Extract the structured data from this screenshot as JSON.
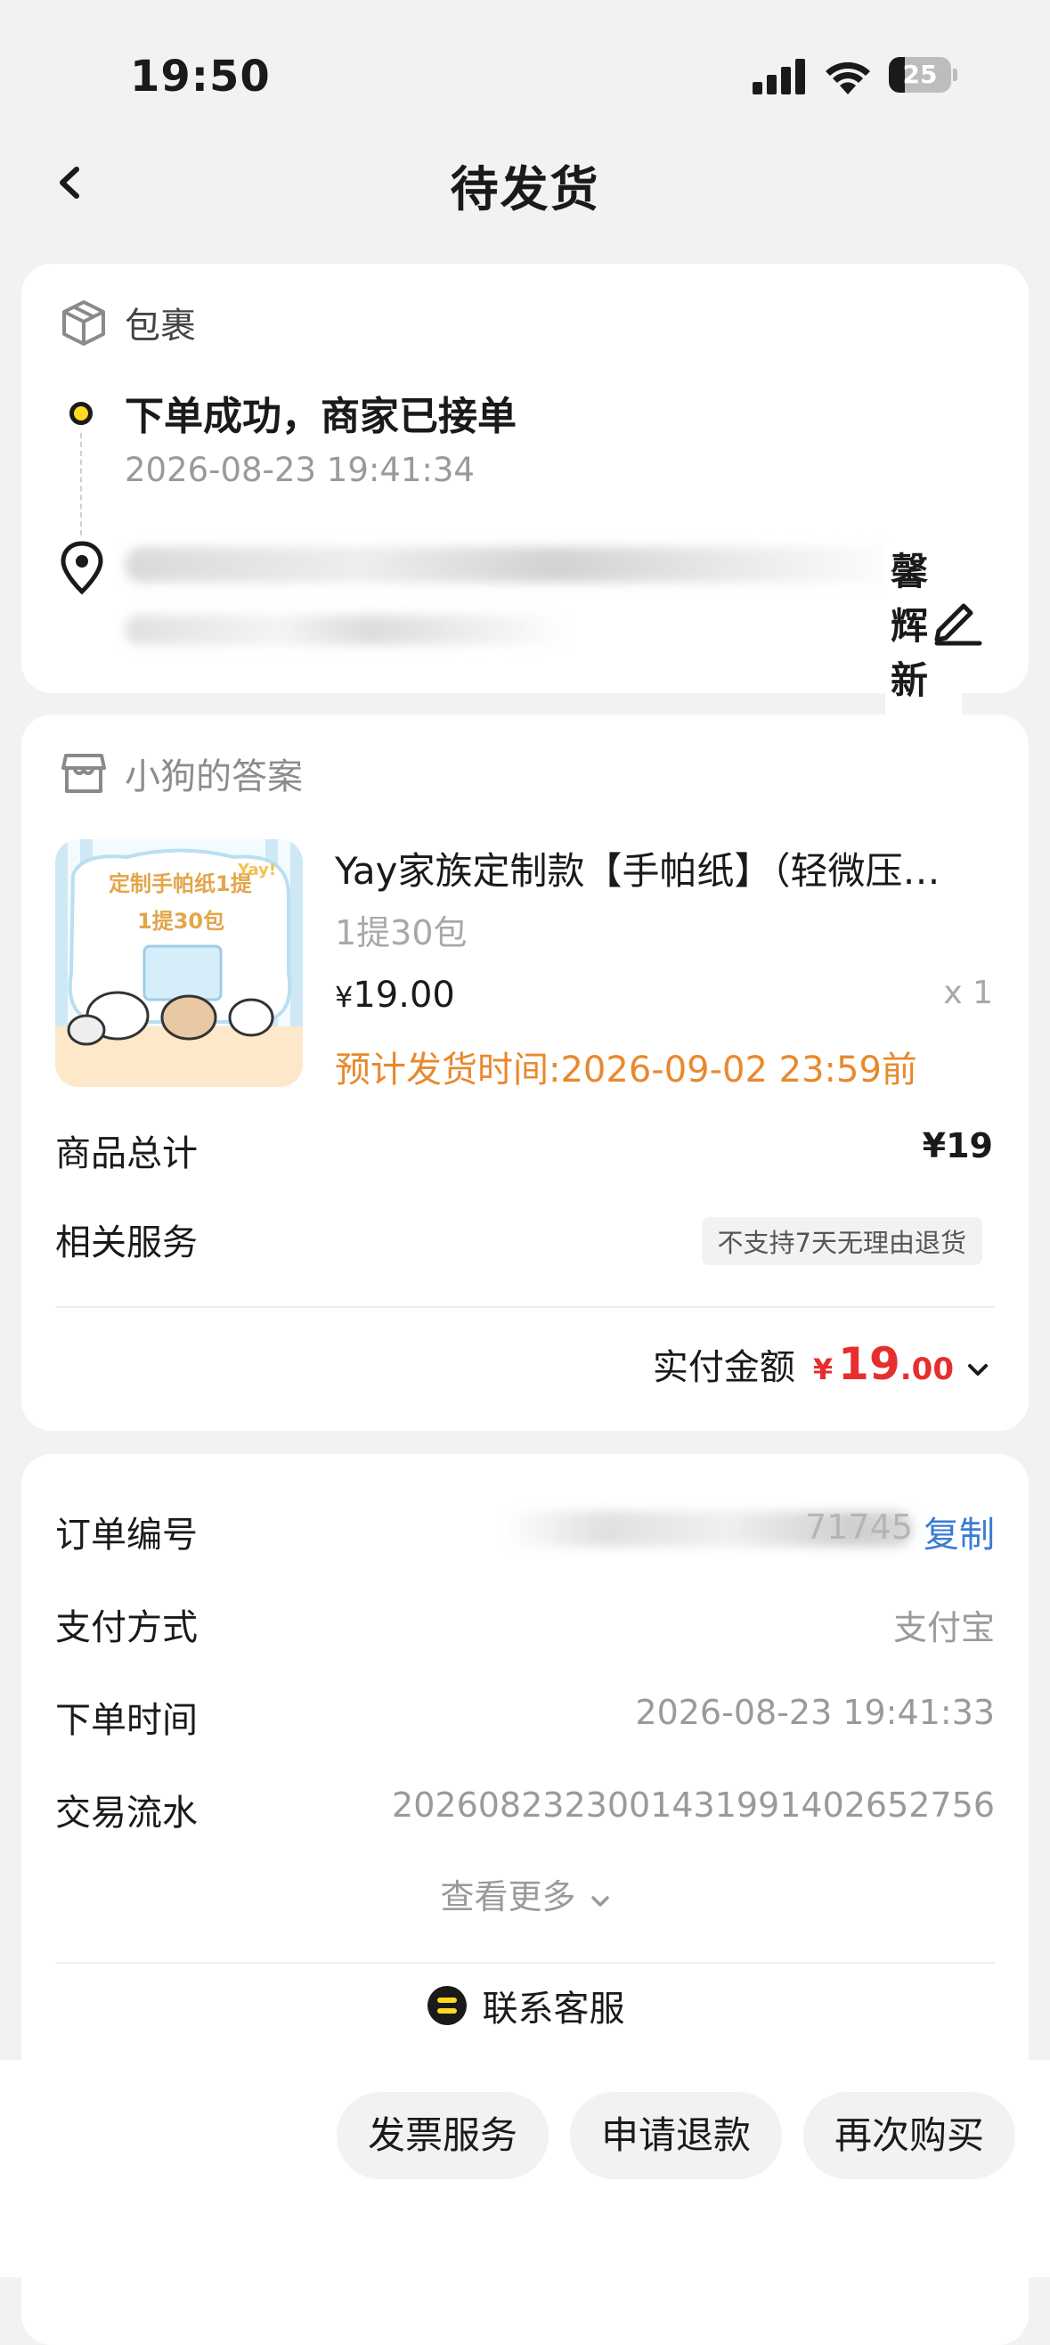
{
  "status_bar": {
    "time": "19:50",
    "battery": "25",
    "battery_level": 0.25
  },
  "nav": {
    "title": "待发货"
  },
  "package": {
    "header": "包裹",
    "status_title": "下单成功，商家已接单",
    "status_time": "2026-08-23 19:41:34",
    "address_tail": "馨辉新村"
  },
  "shop": {
    "name": "小狗的答案",
    "product": {
      "name": "Yay家族定制款【手帕纸】（轻微压…",
      "spec": "1提30包",
      "price_currency": "¥",
      "price": "19.00",
      "qty": "x 1",
      "ship_time": "预计发货时间:2026-09-02 23:59前",
      "image_text_1": "定制手帕纸1提",
      "image_text_2": "1提30包",
      "image_text_3": "Yay!"
    },
    "total_label": "商品总计",
    "total_value": "¥19",
    "service_label": "相关服务",
    "service_badge": "不支持7天无理由退货",
    "paid_label": "实付金额",
    "paid_currency": "¥",
    "paid_int": "19",
    "paid_dec": ".00"
  },
  "order_info": {
    "order_no_label": "订单编号",
    "order_no_visible": "71745",
    "copy": "复制",
    "pay_method_label": "支付方式",
    "pay_method": "支付宝",
    "order_time_label": "下单时间",
    "order_time": "2026-08-23 19:41:33",
    "serial_label": "交易流水",
    "serial": "2026082323001431991402652756",
    "more": "查看更多",
    "customer_service": "联系客服"
  },
  "actions": {
    "invoice": "发票服务",
    "refund": "申请退款",
    "rebuy": "再次购买"
  },
  "colors": {
    "accent_yellow": "#ffd81f",
    "price_red": "#e62e2e",
    "ship_orange": "#e8892d",
    "link_blue": "#3a7bd5"
  }
}
